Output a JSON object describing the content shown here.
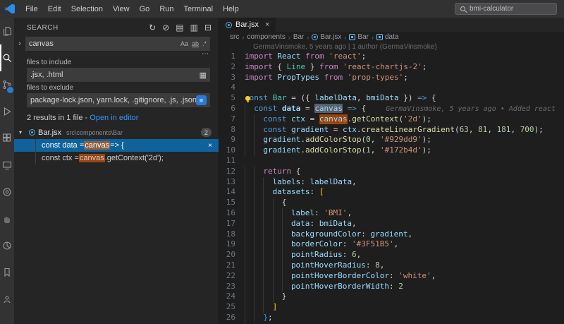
{
  "colors": {
    "accent": "#2b7bd4",
    "selection": "#0e639c",
    "link": "#3794ff",
    "match_highlight": "rgba(234,92,0,0.6)"
  },
  "titlebar": {
    "menus": [
      "File",
      "Edit",
      "Selection",
      "View",
      "Go",
      "Run",
      "Terminal",
      "Help"
    ],
    "window_search": "bmi-calculator"
  },
  "activity_bar": {
    "items": [
      {
        "name": "explorer-icon",
        "active": false,
        "badge": false
      },
      {
        "name": "search-icon",
        "active": true,
        "badge": false
      },
      {
        "name": "source-control-icon",
        "active": false,
        "badge": true
      },
      {
        "name": "run-debug-icon",
        "active": false,
        "badge": false
      },
      {
        "name": "extensions-icon",
        "active": false,
        "badge": false
      },
      {
        "name": "remote-monitor-icon",
        "active": false,
        "badge": false
      },
      {
        "name": "camera-icon",
        "active": false,
        "badge": false
      },
      {
        "name": "hand-icon",
        "active": false,
        "badge": false
      },
      {
        "name": "pie-chart-icon",
        "active": false,
        "badge": false
      },
      {
        "name": "bookmark-icon",
        "active": false,
        "badge": false
      },
      {
        "name": "broadcast-icon",
        "active": false,
        "badge": false
      }
    ]
  },
  "search_panel": {
    "title": "SEARCH",
    "header_actions": [
      {
        "name": "refresh-icon",
        "glyph": "↻"
      },
      {
        "name": "clear-results-icon",
        "glyph": "⊘"
      },
      {
        "name": "open-search-editor-icon",
        "glyph": "▤"
      },
      {
        "name": "view-as-tree-icon",
        "glyph": "▥"
      },
      {
        "name": "collapse-all-icon",
        "glyph": "⊟"
      }
    ],
    "expand_replace_glyph": "›",
    "query": "canvas",
    "search_toggles": [
      {
        "name": "match-case-toggle",
        "glyph": "Aa",
        "cls": ""
      },
      {
        "name": "whole-word-toggle",
        "glyph": "ab",
        "cls": "tg-word"
      },
      {
        "name": "regex-toggle",
        "glyph": ".*",
        "cls": ""
      }
    ],
    "more_glyph": "⋯",
    "include": {
      "label": "files to include",
      "value": ".jsx, .html",
      "icon_glyph": "▦"
    },
    "exclude": {
      "label": "files to exclude",
      "value": "package-lock.json, yarn.lock, .gitignore, .js, .json, .y...",
      "icon_glyph": "≡"
    },
    "summary": {
      "text": "2 results in 1 file - ",
      "link": "Open in editor"
    },
    "file_group": {
      "chevron": "▾",
      "file": "Bar.jsx",
      "path": "src\\components\\Bar",
      "badge": "2"
    },
    "matches": [
      {
        "before": "const data = ",
        "match": "canvas",
        "after": " => {",
        "selected": true,
        "dismiss": "×"
      },
      {
        "before": "const ctx = ",
        "match": "canvas",
        "after": ".getContext('2d');",
        "selected": false
      }
    ]
  },
  "editor": {
    "tab": {
      "label": "Bar.jsx",
      "close": "×"
    },
    "breadcrumb_separator": "›",
    "breadcrumbs": [
      {
        "label": "src",
        "icon": ""
      },
      {
        "label": "components",
        "icon": ""
      },
      {
        "label": "Bar",
        "icon": ""
      },
      {
        "label": "Bar.jsx",
        "icon": "react-file-icon"
      },
      {
        "label": "Bar",
        "icon": "symbol-variable-icon"
      },
      {
        "label": "data",
        "icon": "symbol-variable-icon"
      }
    ],
    "lens": "GermaVinsmoke, 5 years ago | 1 author (GermaVinsmoke)",
    "palette": {
      "kw": "#C586C0",
      "st": "#569CD6",
      "cls": "#4EC9B0",
      "var": "#9CDCFE",
      "varb": "#9CDCFE",
      "str": "#CE9178",
      "num": "#B5CEA8",
      "fn": "#DCDCAA",
      "pun": "#D4D4D4",
      "bry": "#FFD700",
      "brb": "#179FFF"
    },
    "lines": [
      {
        "n": "1",
        "ind": 0,
        "t": [
          [
            "import ",
            "kw"
          ],
          [
            "React ",
            "var"
          ],
          [
            "from ",
            "kw"
          ],
          [
            "'react'",
            "str"
          ],
          [
            ";",
            "pun"
          ]
        ]
      },
      {
        "n": "2",
        "ind": 0,
        "t": [
          [
            "import ",
            "kw"
          ],
          [
            "{ ",
            "pun"
          ],
          [
            "Line",
            "cls"
          ],
          [
            " } ",
            "pun"
          ],
          [
            "from ",
            "kw"
          ],
          [
            "'react-chartjs-2'",
            "str"
          ],
          [
            ";",
            "pun"
          ]
        ]
      },
      {
        "n": "3",
        "ind": 0,
        "t": [
          [
            "import ",
            "kw"
          ],
          [
            "PropTypes ",
            "var"
          ],
          [
            "from ",
            "kw"
          ],
          [
            "'prop-types'",
            "str"
          ],
          [
            ";",
            "pun"
          ]
        ]
      },
      {
        "n": "4",
        "ind": 0,
        "t": []
      },
      {
        "n": "5",
        "ind": 0,
        "lightbulb": true,
        "t": [
          [
            "const ",
            "st"
          ],
          [
            "Bar",
            "cls"
          ],
          [
            " = ",
            "pun"
          ],
          [
            "({ ",
            "pun"
          ],
          [
            "labelData",
            "var"
          ],
          [
            ", ",
            "pun"
          ],
          [
            "bmiData",
            "var"
          ],
          [
            " }) ",
            "pun"
          ],
          [
            "=> ",
            "st"
          ],
          [
            "{",
            "pun"
          ]
        ]
      },
      {
        "n": "6",
        "ind": 1,
        "blame": "GermaVinsmoke, 5 years ago • Added react",
        "t": [
          [
            "const ",
            "st"
          ],
          [
            "data",
            "varb"
          ],
          [
            " = ",
            "pun"
          ],
          [
            "canvas",
            "var",
            "cur"
          ],
          [
            " => ",
            "st"
          ],
          [
            "{",
            "pun"
          ]
        ]
      },
      {
        "n": "7",
        "ind": 2,
        "t": [
          [
            "const ",
            "st"
          ],
          [
            "ctx",
            "var"
          ],
          [
            " = ",
            "pun"
          ],
          [
            "canvas",
            "var",
            "hl"
          ],
          [
            ".",
            "pun"
          ],
          [
            "getContext",
            "fn"
          ],
          [
            "(",
            "pun"
          ],
          [
            "'2d'",
            "str"
          ],
          [
            ");",
            "pun"
          ]
        ]
      },
      {
        "n": "8",
        "ind": 2,
        "t": [
          [
            "const ",
            "st"
          ],
          [
            "gradient",
            "var"
          ],
          [
            " = ",
            "pun"
          ],
          [
            "ctx",
            "var"
          ],
          [
            ".",
            "pun"
          ],
          [
            "createLinearGradient",
            "fn"
          ],
          [
            "(",
            "pun"
          ],
          [
            "63",
            "num"
          ],
          [
            ", ",
            "pun"
          ],
          [
            "81",
            "num"
          ],
          [
            ", ",
            "pun"
          ],
          [
            "181",
            "num"
          ],
          [
            ", ",
            "pun"
          ],
          [
            "700",
            "num"
          ],
          [
            ");",
            "pun"
          ]
        ]
      },
      {
        "n": "9",
        "ind": 2,
        "t": [
          [
            "gradient",
            "var"
          ],
          [
            ".",
            "pun"
          ],
          [
            "addColorStop",
            "fn"
          ],
          [
            "(",
            "pun"
          ],
          [
            "0",
            "num"
          ],
          [
            ", ",
            "pun"
          ],
          [
            "'#929dd9'",
            "str"
          ],
          [
            ");",
            "pun"
          ]
        ]
      },
      {
        "n": "10",
        "ind": 2,
        "t": [
          [
            "gradient",
            "var"
          ],
          [
            ".",
            "pun"
          ],
          [
            "addColorStop",
            "fn"
          ],
          [
            "(",
            "pun"
          ],
          [
            "1",
            "num"
          ],
          [
            ", ",
            "pun"
          ],
          [
            "'#172b4d'",
            "str"
          ],
          [
            ");",
            "pun"
          ]
        ]
      },
      {
        "n": "11",
        "ind": 0,
        "t": []
      },
      {
        "n": "12",
        "ind": 2,
        "t": [
          [
            "return ",
            "kw"
          ],
          [
            "{",
            "pun"
          ]
        ]
      },
      {
        "n": "13",
        "ind": 3,
        "t": [
          [
            "labels",
            "var"
          ],
          [
            ": ",
            "pun"
          ],
          [
            "labelData",
            "var"
          ],
          [
            ",",
            "pun"
          ]
        ]
      },
      {
        "n": "14",
        "ind": 3,
        "t": [
          [
            "datasets",
            "var"
          ],
          [
            ": ",
            "pun"
          ],
          [
            "[",
            "bry"
          ]
        ]
      },
      {
        "n": "15",
        "ind": 4,
        "t": [
          [
            "{",
            "pun"
          ]
        ]
      },
      {
        "n": "16",
        "ind": 5,
        "t": [
          [
            "label",
            "var"
          ],
          [
            ": ",
            "pun"
          ],
          [
            "'BMI'",
            "str"
          ],
          [
            ",",
            "pun"
          ]
        ]
      },
      {
        "n": "17",
        "ind": 5,
        "t": [
          [
            "data",
            "var"
          ],
          [
            ": ",
            "pun"
          ],
          [
            "bmiData",
            "var"
          ],
          [
            ",",
            "pun"
          ]
        ]
      },
      {
        "n": "18",
        "ind": 5,
        "t": [
          [
            "backgroundColor",
            "var"
          ],
          [
            ": ",
            "pun"
          ],
          [
            "gradient",
            "var"
          ],
          [
            ",",
            "pun"
          ]
        ]
      },
      {
        "n": "19",
        "ind": 5,
        "t": [
          [
            "borderColor",
            "var"
          ],
          [
            ": ",
            "pun"
          ],
          [
            "'#3F51B5'",
            "str"
          ],
          [
            ",",
            "pun"
          ]
        ]
      },
      {
        "n": "20",
        "ind": 5,
        "t": [
          [
            "pointRadius",
            "var"
          ],
          [
            ": ",
            "pun"
          ],
          [
            "6",
            "num"
          ],
          [
            ",",
            "pun"
          ]
        ]
      },
      {
        "n": "21",
        "ind": 5,
        "t": [
          [
            "pointHoverRadius",
            "var"
          ],
          [
            ": ",
            "pun"
          ],
          [
            "8",
            "num"
          ],
          [
            ",",
            "pun"
          ]
        ]
      },
      {
        "n": "22",
        "ind": 5,
        "t": [
          [
            "pointHoverBorderColor",
            "var"
          ],
          [
            ": ",
            "pun"
          ],
          [
            "'white'",
            "str"
          ],
          [
            ",",
            "pun"
          ]
        ]
      },
      {
        "n": "23",
        "ind": 5,
        "t": [
          [
            "pointHoverBorderWidth",
            "var"
          ],
          [
            ": ",
            "pun"
          ],
          [
            "2",
            "num"
          ]
        ]
      },
      {
        "n": "24",
        "ind": 4,
        "t": [
          [
            "}",
            "pun"
          ]
        ]
      },
      {
        "n": "25",
        "ind": 3,
        "t": [
          [
            "]",
            "bry"
          ]
        ]
      },
      {
        "n": "26",
        "ind": 2,
        "t": [
          [
            "}",
            "brb"
          ],
          [
            ";",
            "pun"
          ]
        ]
      }
    ]
  }
}
